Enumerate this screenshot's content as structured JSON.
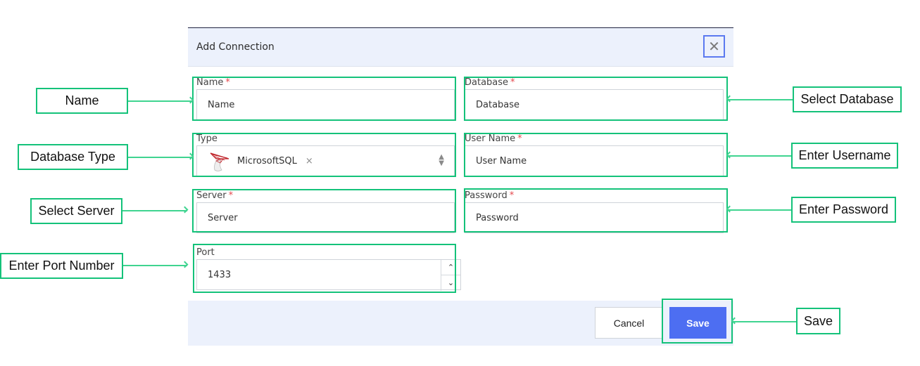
{
  "dialog": {
    "title": "Add Connection",
    "close_icon": "close-icon"
  },
  "fields": {
    "name": {
      "label": "Name",
      "required": "*",
      "placeholder": "Name",
      "value": ""
    },
    "database": {
      "label": "Database",
      "required": "*",
      "placeholder": "Database",
      "value": ""
    },
    "type": {
      "label": "Type",
      "selected": "MicrosoftSQL",
      "icon": "mssql-logo-icon",
      "clear": "×",
      "toggle_icon": "chevron-updown-icon"
    },
    "username": {
      "label": "User Name",
      "required": "*",
      "placeholder": "User Name",
      "value": ""
    },
    "server": {
      "label": "Server",
      "required": "*",
      "placeholder": "Server",
      "value": ""
    },
    "password": {
      "label": "Password",
      "required": "*",
      "placeholder": "Password",
      "value": ""
    },
    "port": {
      "label": "Port",
      "value": "1433",
      "up": "︿",
      "down": "﹀"
    }
  },
  "footer": {
    "cancel_label": "Cancel",
    "save_label": "Save"
  },
  "annotations": {
    "name": "Name",
    "database_type": "Database Type",
    "select_server": "Select Server",
    "port": "Enter Port Number",
    "select_database": "Select Database",
    "username": "Enter Username",
    "password": "Enter Password",
    "save": "Save"
  },
  "colors": {
    "accent": "#4d6ef2",
    "annotation": "#14c27a",
    "header_bg": "#ecf1fc",
    "required": "#e5484d"
  }
}
